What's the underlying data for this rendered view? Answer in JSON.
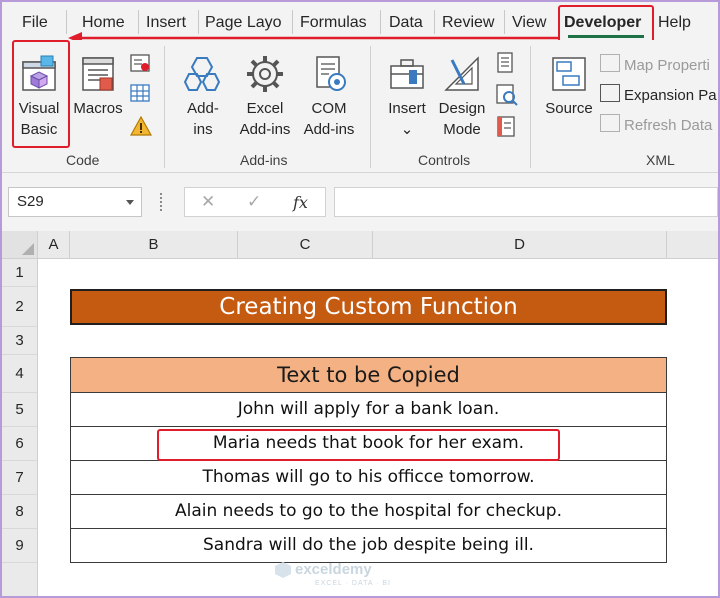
{
  "tabs": [
    "File",
    "Home",
    "Insert",
    "Page Layo",
    "Formulas",
    "Data",
    "Review",
    "View",
    "Developer",
    "Help"
  ],
  "active_tab": "Developer",
  "ribbon": {
    "code": {
      "label": "Code",
      "visual_basic": [
        "Visual",
        "Basic"
      ],
      "macros": "Macros"
    },
    "addins": {
      "label": "Add-ins",
      "addins": [
        "Add-",
        "ins"
      ],
      "excel_addins": [
        "Excel",
        "Add-ins"
      ],
      "com_addins": [
        "COM",
        "Add-ins"
      ]
    },
    "controls": {
      "label": "Controls",
      "insert": "Insert",
      "insert_caret": "⌄",
      "design_mode": [
        "Design",
        "Mode"
      ]
    },
    "xml": {
      "label": "XML",
      "source": "Source",
      "map_properties": "Map Properti",
      "expansion_packs": "Expansion Pa",
      "refresh_data": "Refresh Data"
    }
  },
  "formula_bar": {
    "name_box": "S29",
    "cancel_glyph": "✕",
    "enter_glyph": "✓",
    "fx_glyph": "fx",
    "formula": ""
  },
  "columns": [
    "A",
    "B",
    "C",
    "D"
  ],
  "rows": [
    "1",
    "2",
    "3",
    "4",
    "5",
    "6",
    "7",
    "8",
    "9"
  ],
  "sheet": {
    "title": "Creating Custom Function",
    "header": "Text to be Copied",
    "items": [
      "John will apply for a bank loan.",
      "Maria needs that book for her exam.",
      "Thomas will go to his officce tomorrow.",
      "Alain needs to go to the hospital for checkup.",
      "Sandra will do the job despite being ill."
    ]
  },
  "watermark": {
    "name": "exceldemy",
    "tagline": "EXCEL · DATA · BI"
  },
  "colors": {
    "highlight_red": "#e01e2b",
    "title_fill": "#c55a11",
    "header_fill": "#f4b183",
    "developer_underline": "#1e7145"
  }
}
